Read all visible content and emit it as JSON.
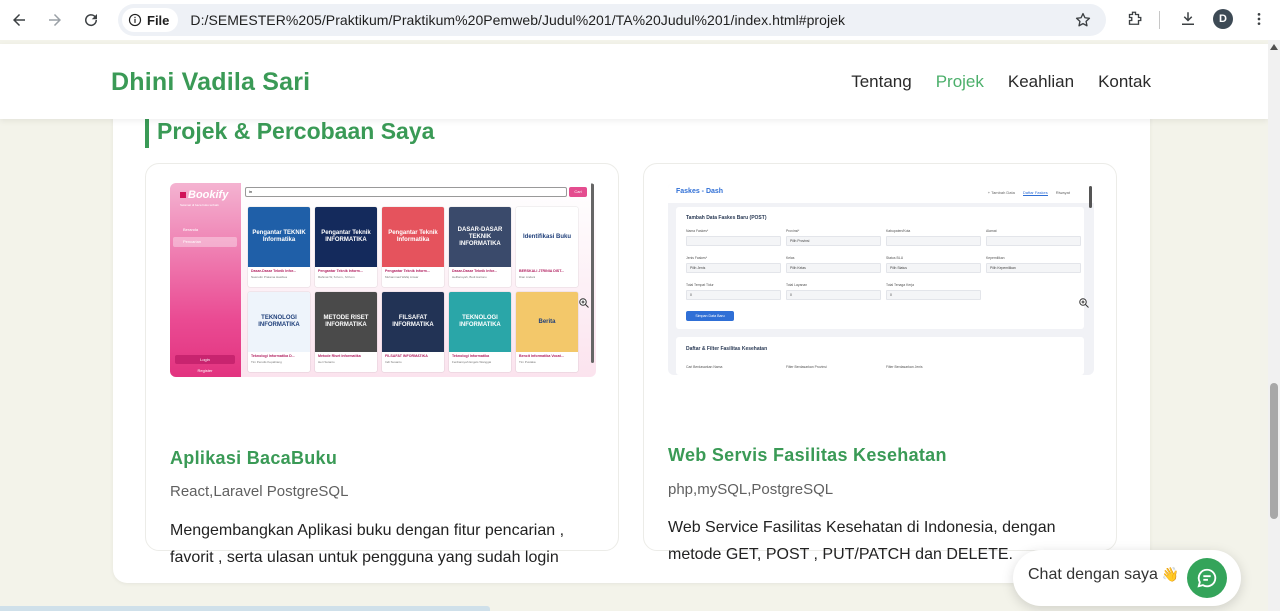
{
  "browser": {
    "file_chip": "File",
    "url": "D:/SEMESTER%205/Praktikum/Praktikum%20Pemweb/Judul%201/TA%20Judul%201/index.html#projek",
    "avatar_letter": "D"
  },
  "header": {
    "brand": "Dhini Vadila Sari",
    "nav": [
      "Tentang",
      "Projek",
      "Keahlian",
      "Kontak"
    ],
    "active_nav": "Projek"
  },
  "section": {
    "title": "Projek & Percobaan Saya"
  },
  "projects": [
    {
      "title": "Aplikasi BacaBuku",
      "tech": "React,Laravel PostgreSQL",
      "description": "Mengembangkan Aplikasi buku dengan fitur pencarian , favorit , serta ulasan untuk pengguna yang sudah login"
    },
    {
      "title": "Web Servis Fasilitas Kesehatan",
      "tech": "php,mySQL,PostgreSQL",
      "description": "Web Service Fasilitas Kesehatan di Indonesia, dengan metode GET, POST , PUT/PATCH dan DELETE."
    }
  ],
  "bookify": {
    "logo": "Bookify",
    "tagline": "Selamat di baca buku terbaik",
    "menu": [
      "Beranda",
      "Pencarian"
    ],
    "login": "Login",
    "register": "Register",
    "search_value": "in",
    "search_button": "Cari",
    "books": [
      {
        "cover": "Pengantar TEKNIK Informatika",
        "title": "Dasar-Dasar Teknik Infor...",
        "author": "Nasrudin Pratama Hasibua",
        "color": "#1f5fa8"
      },
      {
        "cover": "Pengantar Teknik INFORMATIKA",
        "title": "Pengantar Teknik Inform...",
        "author": "Rahmat W, S.Kom., M.Kom",
        "color": "#142a5c"
      },
      {
        "cover": "Pengantar Teknik Informatika",
        "title": "Pengantar Teknik Inform...",
        "author": "Muhammad Wafiq Anwar",
        "color": "#e5535d"
      },
      {
        "cover": "DASAR-DASAR TEKNIK INFORMATIKA",
        "title": "Dasar-Dasar Teknik Infor...",
        "author": "Helfiansyah, Budi Hartono",
        "color": "#3a4a6b"
      },
      {
        "cover": "Identifikasi Buku",
        "title": "BERSKALI JTRINIA DIST...",
        "author": "Dian Andani",
        "color": "#ffffff"
      },
      {
        "cover": "TEKNOLOGI INFORMATIKA",
        "title": "Teknologi Informatika D...",
        "author": "Tim Penulis Kepahiang",
        "color": "#eef4fb"
      },
      {
        "cover": "METODE RISET INFORMATIKA",
        "title": "Metode Riset Informatika",
        "author": "Heri Sutanto",
        "color": "#4a4a4a"
      },
      {
        "cover": "FILSAFAT INFORMATIKA",
        "title": "FILSAFAT INFORMATIKA",
        "author": "Indi Susanto",
        "color": "#223355"
      },
      {
        "cover": "TEKNOLOGI INFORMATIKA",
        "title": "Teknologi Informatika",
        "author": "Ferdiansyah Engels Wanggai",
        "color": "#2aa6a8"
      },
      {
        "cover": "Berita",
        "title": "Bencit Informatika Vocat...",
        "author": "Tim Pustaka",
        "color": "#f3c86a"
      }
    ]
  },
  "faskes": {
    "brand": "Faskes - Dash",
    "nav": [
      "+ Tambah Data",
      "Daftar Faskes",
      "Riwayat"
    ],
    "panel_title": "Tambah Data Faskes Baru (POST)",
    "labels": [
      "Nama Faskes*",
      "Provinsi*",
      "Kabupaten/Kota",
      "Alamat",
      "Jenis Faskes*",
      "Kelas",
      "Status BLU",
      "Kepemilikan",
      "Total Tempat Tidur",
      "Total Layanan",
      "Total Tenaga Kerja"
    ],
    "selects": [
      "Pilih Provinsi",
      "Pilih Jenis",
      "Pilih Kelas",
      "Pilih Status",
      "Pilih Kepemilikan"
    ],
    "zeros": [
      "0",
      "0",
      "0"
    ],
    "submit": "Simpan Data Baru",
    "list_title": "Daftar & Filter Fasilitas Kesehatan",
    "filters": [
      "Cari Berdasarkan Nama",
      "Filter Berdasarkan Provinsi",
      "Filter Berdasarkan Jenis"
    ]
  },
  "chat": {
    "label": "Chat dengan saya",
    "hand": "👋"
  },
  "colors": {
    "accent": "#3a9a56",
    "background": "#f3f3ea",
    "chat_button": "#34a45a"
  },
  "icons": [
    "back-arrow-icon",
    "forward-arrow-icon",
    "reload-icon",
    "info-icon",
    "star-icon",
    "extensions-icon",
    "download-icon",
    "menu-dots-icon",
    "zoom-icon",
    "chat-icon"
  ]
}
